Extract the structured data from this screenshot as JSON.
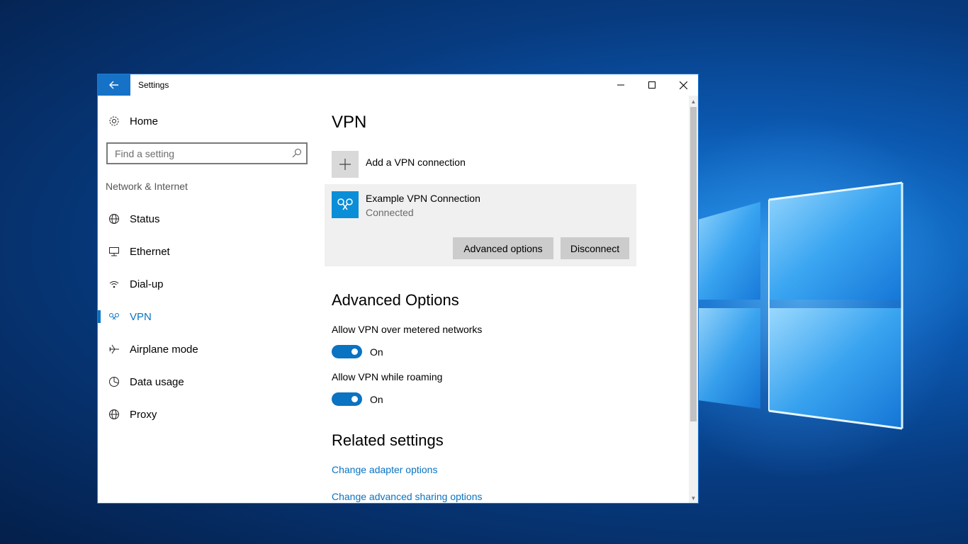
{
  "window": {
    "title": "Settings"
  },
  "sidebar": {
    "home_label": "Home",
    "search_placeholder": "Find a setting",
    "section": "Network & Internet",
    "items": [
      {
        "label": "Status",
        "icon": "globe-status-icon"
      },
      {
        "label": "Ethernet",
        "icon": "ethernet-icon"
      },
      {
        "label": "Dial-up",
        "icon": "dialup-icon"
      },
      {
        "label": "VPN",
        "icon": "vpn-icon",
        "active": true
      },
      {
        "label": "Airplane mode",
        "icon": "airplane-icon"
      },
      {
        "label": "Data usage",
        "icon": "data-usage-icon"
      },
      {
        "label": "Proxy",
        "icon": "globe-icon"
      }
    ]
  },
  "main": {
    "title": "VPN",
    "add_vpn_label": "Add a VPN connection",
    "connection": {
      "name": "Example VPN Connection",
      "status": "Connected",
      "advanced_button": "Advanced options",
      "disconnect_button": "Disconnect"
    },
    "advanced": {
      "heading": "Advanced Options",
      "metered_label": "Allow VPN over metered networks",
      "metered_state": "On",
      "roaming_label": "Allow VPN while roaming",
      "roaming_state": "On"
    },
    "related": {
      "heading": "Related settings",
      "link1": "Change adapter options",
      "link2": "Change advanced sharing options"
    }
  },
  "colors": {
    "accent": "#0a73c2",
    "back_button": "#1672c6",
    "vpn_tile": "#0a8ed8"
  }
}
